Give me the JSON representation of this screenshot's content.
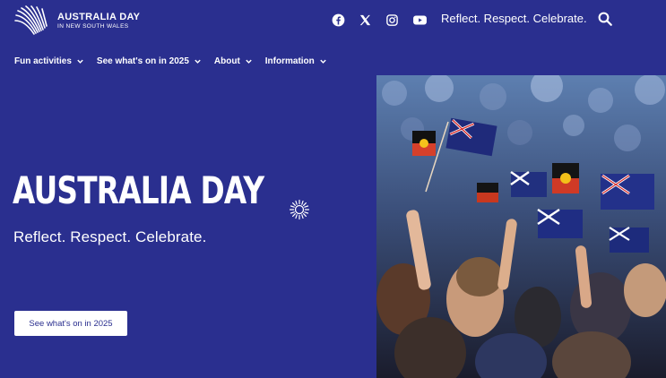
{
  "brand": {
    "logo_title": "AUSTRALIA DAY",
    "logo_subtitle": "IN NEW SOUTH WALES",
    "primary_color": "#2a2f8f",
    "text_color": "#ffffff"
  },
  "header": {
    "social_icons": [
      "facebook-icon",
      "x-icon",
      "instagram-icon",
      "youtube-icon"
    ],
    "tagline": "Reflect. Respect. Celebrate.",
    "search_icon": "search-icon"
  },
  "nav": {
    "items": [
      {
        "label": "Fun activities"
      },
      {
        "label": "See what's on in 2025"
      },
      {
        "label": "About"
      },
      {
        "label": "Information"
      }
    ]
  },
  "hero": {
    "title": "AUSTRALIA DAY",
    "subtitle": "Reflect. Respect. Celebrate.",
    "cta_label": "See what's on in 2025",
    "image_alt": "Crowd waving Australian and Aboriginal flags"
  }
}
